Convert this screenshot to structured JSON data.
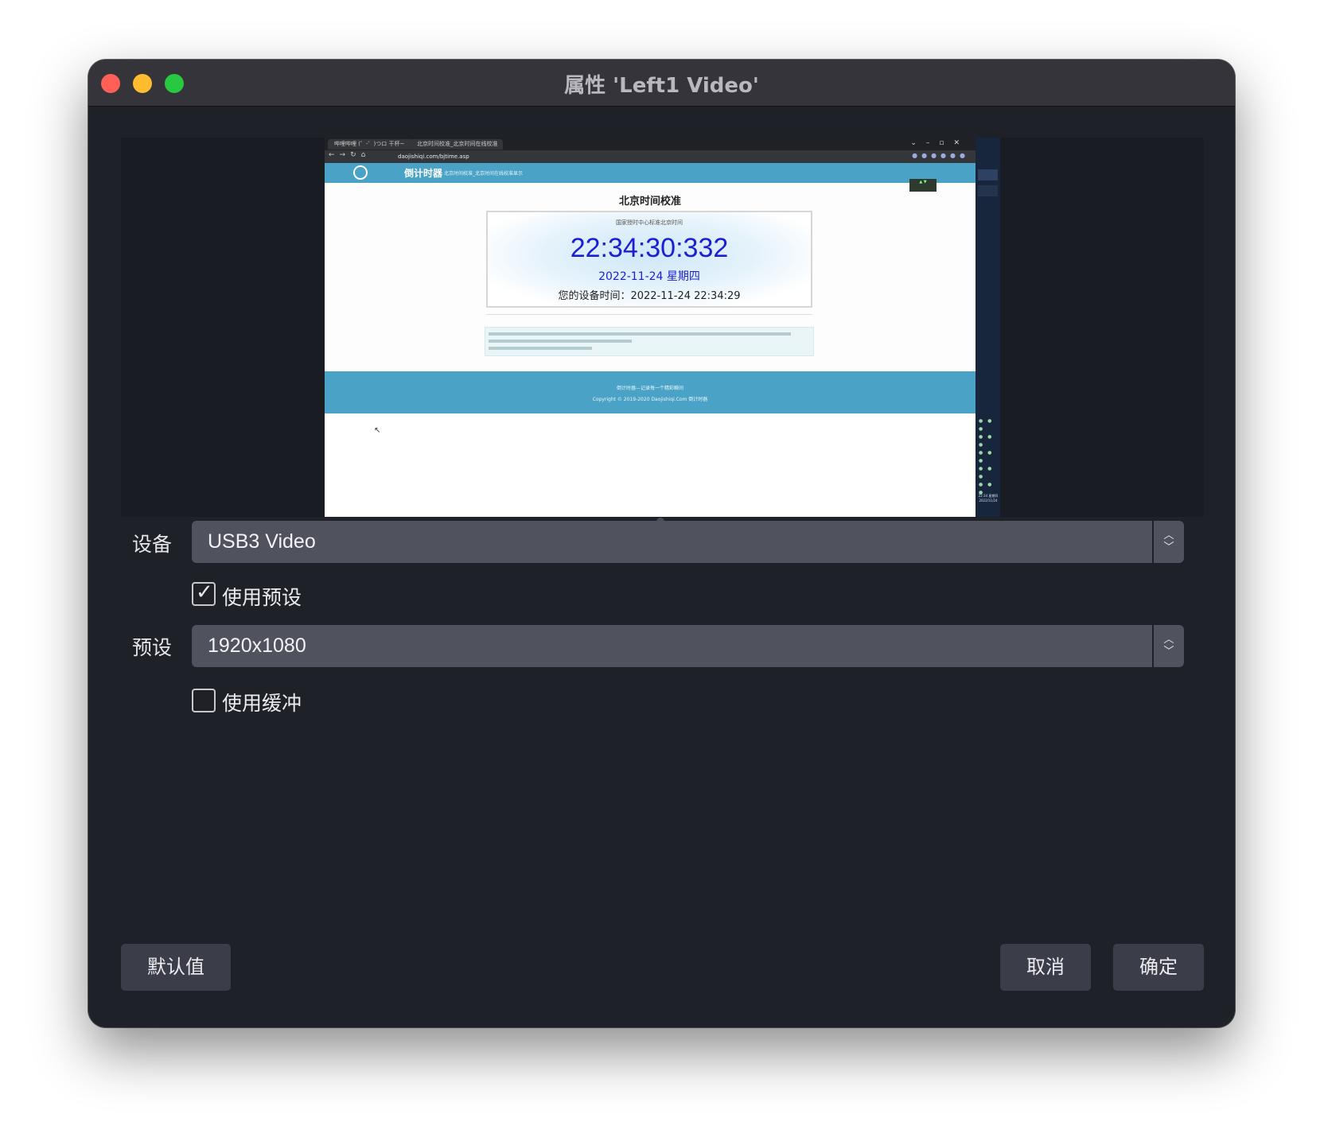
{
  "window": {
    "title": "属性 'Left1 Video'"
  },
  "preview": {
    "browser": {
      "tab1": "哔哩哔哩 (゜-゜)つロ 干杯~",
      "tab2": "北京时间校准_北京时间在线校准",
      "url": "daojishiqi.com/bjtime.asp"
    },
    "site": {
      "name": "倒计时器",
      "tagline": "北京时间校准_北京时间在线校准显示",
      "page_title": "北京时间校准",
      "clock_source": "国家授时中心标准北京时间",
      "clock_time": "22:34:30:332",
      "clock_date": "2022-11-24 星期四",
      "device_time": "您的设备时间：2022-11-24 22:34:29",
      "footer_line1": "倒计时器—记录每一个精彩瞬间",
      "footer_line2": "Copyright © 2019-2020 Daojishiqi.Com 倒计时器"
    },
    "taskbar_clock": "22:34 星期四 2022/11/24"
  },
  "form": {
    "device_label": "设备",
    "device_value": "USB3 Video",
    "use_preset_label": "使用预设",
    "use_preset_checked": true,
    "preset_label": "预设",
    "preset_value": "1920x1080",
    "use_buffer_label": "使用缓冲",
    "use_buffer_checked": false
  },
  "buttons": {
    "defaults": "默认值",
    "cancel": "取消",
    "ok": "确定"
  },
  "icons": {
    "select_arrows": "chevron-up-down-icon",
    "checkmark": "check-icon"
  },
  "colors": {
    "window_bg": "#1f2129",
    "titlebar_bg": "#35343b",
    "select_bg": "#50525e",
    "button_bg": "#3b3e49",
    "clock_blue": "#1a1fd4",
    "site_blue": "#4aa3c7"
  }
}
